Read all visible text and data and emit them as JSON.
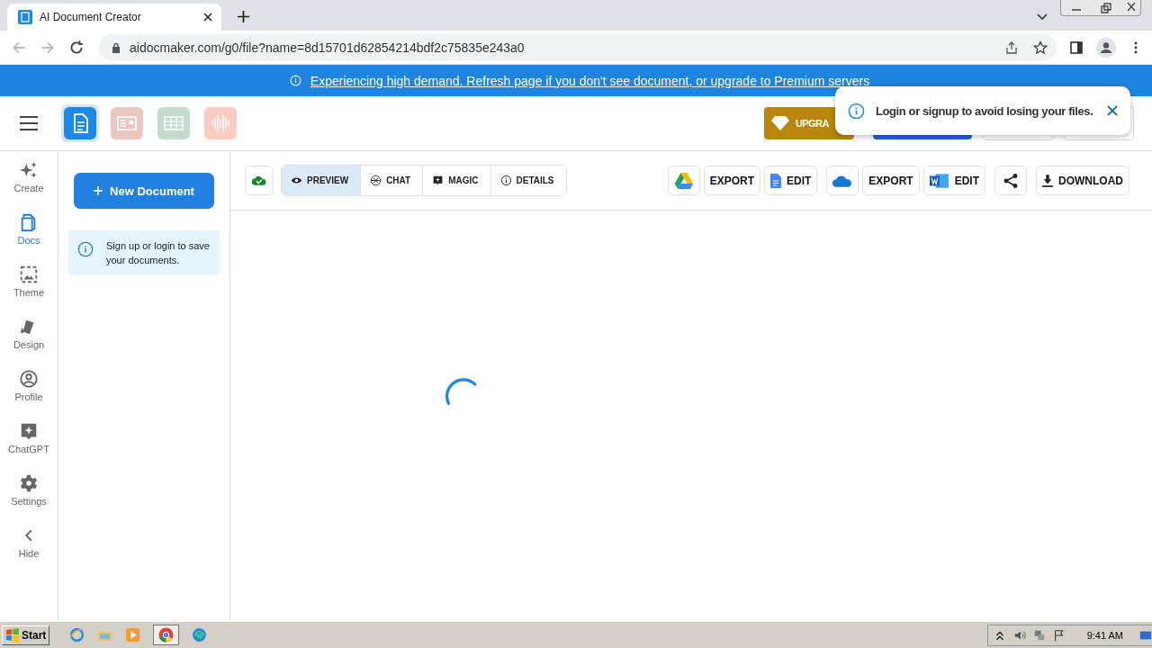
{
  "browser": {
    "tab_title": "AI Document Creator",
    "url": "aidocmaker.com/g0/file?name=8d15701d62854214bdf2c75835e243a0"
  },
  "banner": {
    "text": "Experiencing high demand. Refresh page if you don't see document, or upgrade to Premium servers"
  },
  "header": {
    "apps": [
      {
        "kind": "doc",
        "selected": true
      },
      {
        "kind": "slides",
        "selected": false
      },
      {
        "kind": "sheet",
        "selected": false
      },
      {
        "kind": "audio",
        "selected": false
      }
    ],
    "upgrade_label": "UPGRA"
  },
  "toast": {
    "text": "Login or signup to avoid losing your files."
  },
  "nav": [
    {
      "kind": "create",
      "label": "Create",
      "selected": false
    },
    {
      "kind": "docs",
      "label": "Docs",
      "selected": true
    },
    {
      "kind": "theme",
      "label": "Theme",
      "selected": false
    },
    {
      "kind": "design",
      "label": "Design",
      "selected": false
    },
    {
      "kind": "profile",
      "label": "Profile",
      "selected": false
    },
    {
      "kind": "chatgpt",
      "label": "ChatGPT",
      "selected": false
    },
    {
      "kind": "settings",
      "label": "Settings",
      "selected": false
    },
    {
      "kind": "hide",
      "label": "Hide",
      "selected": false
    }
  ],
  "docs_panel": {
    "new_button": "New Document",
    "notice": "Sign up or login to save your documents."
  },
  "view_tabs": [
    {
      "kind": "preview",
      "label": "PREVIEW",
      "selected": true
    },
    {
      "kind": "chat",
      "label": "CHAT",
      "selected": false
    },
    {
      "kind": "magic",
      "label": "MAGIC",
      "selected": false
    },
    {
      "kind": "details",
      "label": "DETAILS",
      "selected": false
    }
  ],
  "actions": [
    {
      "kind": "drive"
    },
    {
      "kind": "export",
      "label": "EXPORT"
    },
    {
      "kind": "gdocs",
      "label": "EDIT"
    },
    {
      "kind": "onedrive"
    },
    {
      "kind": "export",
      "label": "EXPORT"
    },
    {
      "kind": "word",
      "label": "EDIT"
    },
    {
      "kind": "share"
    },
    {
      "kind": "download",
      "label": "DOWNLOAD"
    }
  ],
  "taskbar": {
    "start": "Start",
    "time": "9:41 AM"
  }
}
